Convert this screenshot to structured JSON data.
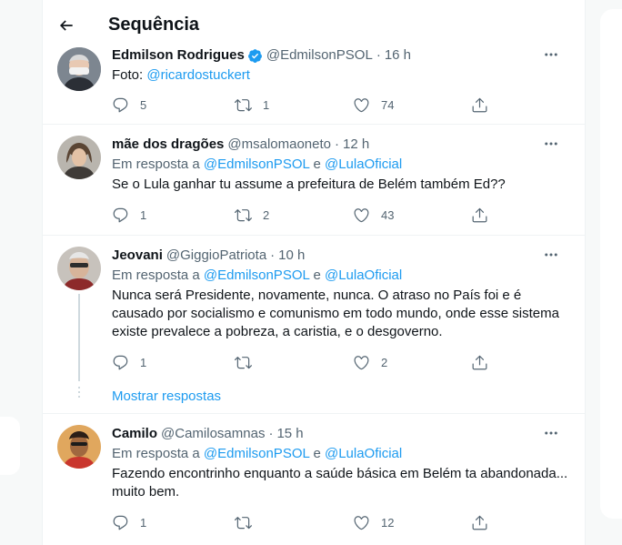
{
  "header": {
    "title": "Sequência"
  },
  "tweets": [
    {
      "name": "Edmilson Rodrigues",
      "handle": "@EdmilsonPSOL",
      "time": "16 h",
      "verified": true,
      "text_prefix": "Foto: ",
      "text_link": "@ricardostuckert",
      "replies": "5",
      "retweets": "1",
      "likes": "74"
    },
    {
      "name": "mãe dos dragões",
      "handle": "@msalomaoneto",
      "time": "12 h",
      "reply_prefix": "Em resposta a ",
      "reply_user1": "@EdmilsonPSOL",
      "reply_and": " e ",
      "reply_user2": "@LulaOficial",
      "text": "Se o Lula ganhar tu assume a prefeitura de Belém também Ed??",
      "replies": "1",
      "retweets": "2",
      "likes": "43"
    },
    {
      "name": "Jeovani",
      "handle": "@GiggioPatriota",
      "time": "10 h",
      "reply_prefix": "Em resposta a ",
      "reply_user1": "@EdmilsonPSOL",
      "reply_and": " e ",
      "reply_user2": "@LulaOficial",
      "text_lines": [
        "Nunca será Presidente, novamente, nunca. O atraso no País foi e é",
        "causado por socialismo e comunismo em todo mundo, onde esse sistema",
        "existe prevalece a pobreza, a caristia, e o desgoverno."
      ],
      "replies": "1",
      "retweets": "",
      "likes": "2",
      "show_replies": "Mostrar respostas"
    },
    {
      "name": "Camilo",
      "handle": "@Camilosamnas",
      "time": "15 h",
      "reply_prefix": "Em resposta a ",
      "reply_user1": "@EdmilsonPSOL",
      "reply_and": " e ",
      "reply_user2": "@LulaOficial",
      "text_lines": [
        "Fazendo encontrinho enquanto a saúde básica em Belém ta abandonada...",
        "muito bem."
      ],
      "replies": "1",
      "retweets": "",
      "likes": "12"
    }
  ],
  "colors": {
    "accent": "#1d9bf0",
    "muted": "#536471",
    "text": "#0f1419",
    "divider": "#eff3f4"
  }
}
